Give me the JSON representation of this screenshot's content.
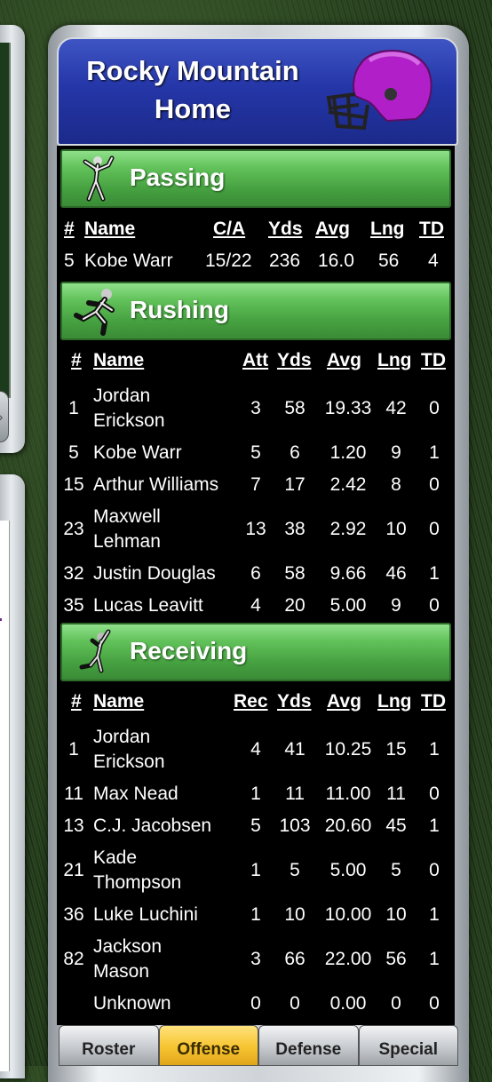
{
  "team": {
    "name_line1": "Rocky Mountain",
    "name_line2": "Home",
    "helmet_color": "#b11fc9"
  },
  "passing": {
    "title": "Passing",
    "headers": {
      "num": "#",
      "name": "Name",
      "ca": "C/A",
      "yds": "Yds",
      "avg": "Avg",
      "lng": "Lng",
      "td": "TD"
    },
    "rows": [
      {
        "num": "5",
        "name": "Kobe Warr",
        "ca": "15/22",
        "yds": "236",
        "avg": "16.0",
        "lng": "56",
        "td": "4"
      }
    ]
  },
  "rushing": {
    "title": "Rushing",
    "headers": {
      "num": "#",
      "name": "Name",
      "att": "Att",
      "yds": "Yds",
      "avg": "Avg",
      "lng": "Lng",
      "td": "TD"
    },
    "rows": [
      {
        "num": "1",
        "name1": "Jordan",
        "name2": "Erickson",
        "att": "3",
        "yds": "58",
        "avg": "19.33",
        "lng": "42",
        "td": "0"
      },
      {
        "num": "5",
        "name1": "Kobe Warr",
        "name2": "",
        "att": "5",
        "yds": "6",
        "avg": "1.20",
        "lng": "9",
        "td": "1"
      },
      {
        "num": "15",
        "name1": "Arthur Williams",
        "name2": "",
        "att": "7",
        "yds": "17",
        "avg": "2.42",
        "lng": "8",
        "td": "0"
      },
      {
        "num": "23",
        "name1": "Maxwell",
        "name2": "Lehman",
        "att": "13",
        "yds": "38",
        "avg": "2.92",
        "lng": "10",
        "td": "0"
      },
      {
        "num": "32",
        "name1": "Justin Douglas",
        "name2": "",
        "att": "6",
        "yds": "58",
        "avg": "9.66",
        "lng": "46",
        "td": "1"
      },
      {
        "num": "35",
        "name1": "Lucas Leavitt",
        "name2": "",
        "att": "4",
        "yds": "20",
        "avg": "5.00",
        "lng": "9",
        "td": "0"
      }
    ]
  },
  "receiving": {
    "title": "Receiving",
    "headers": {
      "num": "#",
      "name": "Name",
      "rec": "Rec",
      "yds": "Yds",
      "avg": "Avg",
      "lng": "Lng",
      "td": "TD"
    },
    "rows": [
      {
        "num": "1",
        "name1": "Jordan",
        "name2": "Erickson",
        "rec": "4",
        "yds": "41",
        "avg": "10.25",
        "lng": "15",
        "td": "1"
      },
      {
        "num": "11",
        "name1": "Max Nead",
        "name2": "",
        "rec": "1",
        "yds": "11",
        "avg": "11.00",
        "lng": "11",
        "td": "0"
      },
      {
        "num": "13",
        "name1": "C.J. Jacobsen",
        "name2": "",
        "rec": "5",
        "yds": "103",
        "avg": "20.60",
        "lng": "45",
        "td": "1"
      },
      {
        "num": "21",
        "name1": "Kade",
        "name2": "Thompson",
        "rec": "1",
        "yds": "5",
        "avg": "5.00",
        "lng": "5",
        "td": "0"
      },
      {
        "num": "36",
        "name1": "Luke Luchini",
        "name2": "",
        "rec": "1",
        "yds": "10",
        "avg": "10.00",
        "lng": "10",
        "td": "1"
      },
      {
        "num": "82",
        "name1": "Jackson",
        "name2": "Mason",
        "rec": "3",
        "yds": "66",
        "avg": "22.00",
        "lng": "56",
        "td": "1"
      },
      {
        "num": "",
        "name1": "Unknown",
        "name2": "",
        "rec": "0",
        "yds": "0",
        "avg": "0.00",
        "lng": "0",
        "td": "0"
      }
    ]
  },
  "tabs": [
    {
      "label": "Roster",
      "active": false
    },
    {
      "label": "Offense",
      "active": true
    },
    {
      "label": "Defense",
      "active": false
    },
    {
      "label": "Special",
      "active": false
    }
  ]
}
